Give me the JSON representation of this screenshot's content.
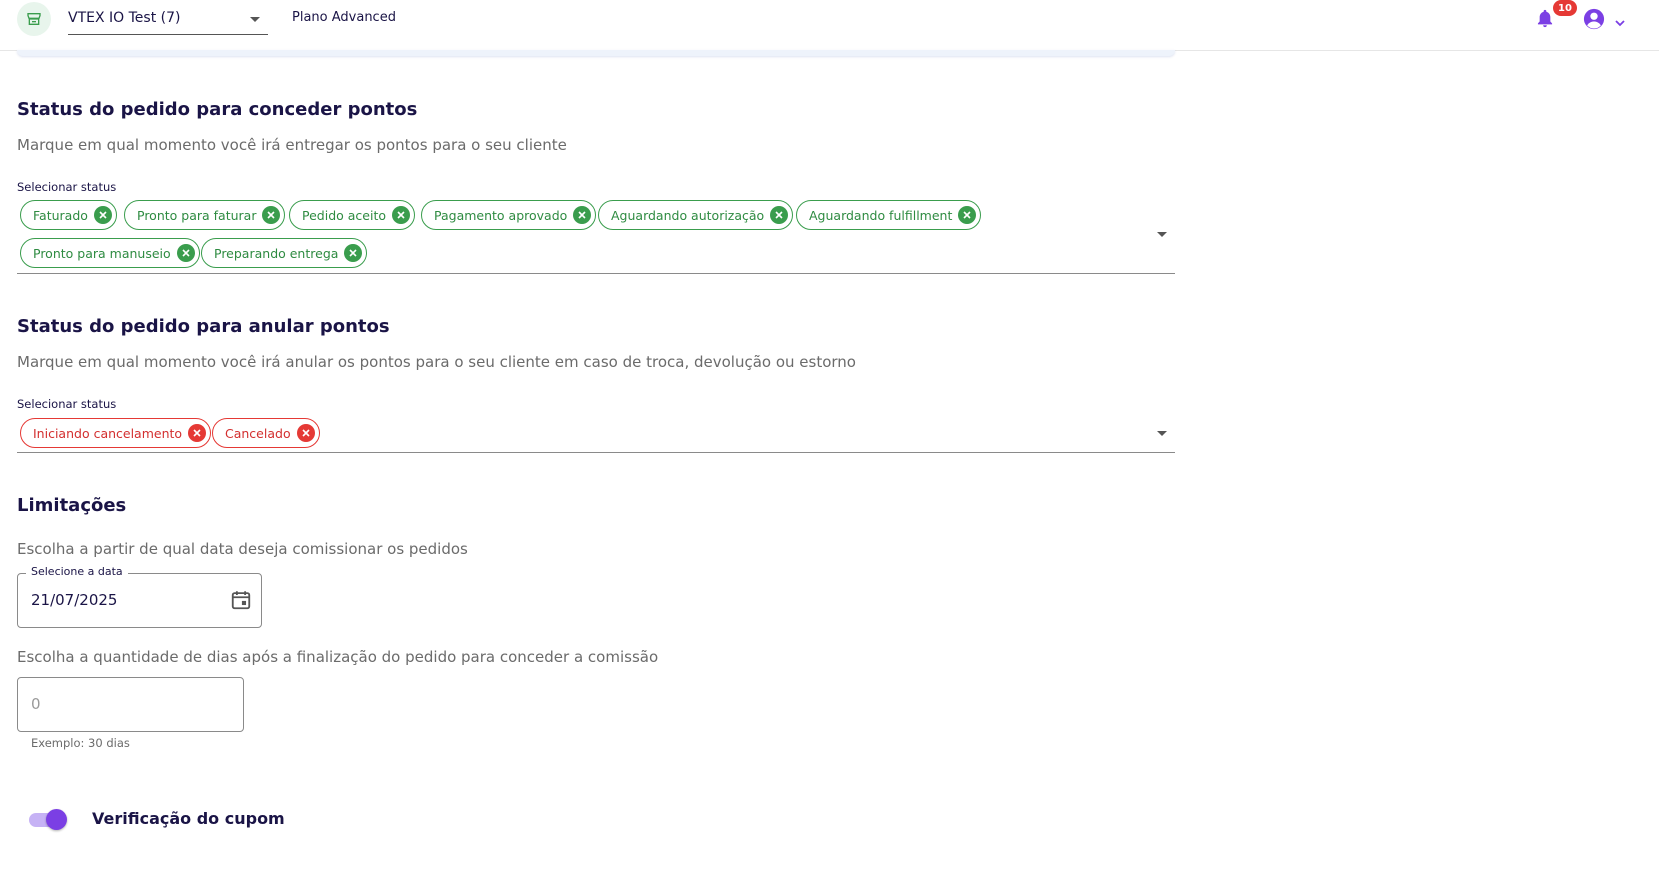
{
  "header": {
    "store_name": "VTEX IO Test (7)",
    "plan": "Plano Advanced",
    "notification_count": "10",
    "icons": [
      "store-icon",
      "bell-icon",
      "account-icon",
      "chevron-down-icon"
    ]
  },
  "grant_section": {
    "title": "Status do pedido para conceder pontos",
    "description": "Marque em qual momento você irá entregar os pontos para o seu cliente",
    "select_label": "Selecionar status",
    "chips": [
      "Faturado",
      "Pronto para faturar",
      "Pedido aceito",
      "Pagamento aprovado",
      "Aguardando autorização",
      "Aguardando fulfillment",
      "Pronto para manuseio",
      "Preparando entrega"
    ],
    "chip_color": "#3a9d4d"
  },
  "cancel_section": {
    "title": "Status do pedido para anular pontos",
    "description": "Marque em qual momento você irá anular os pontos para o seu cliente em caso de troca, devolução ou estorno",
    "select_label": "Selecionar status",
    "chips": [
      "Iniciando cancelamento",
      "Cancelado"
    ],
    "chip_color": "#e53935"
  },
  "limits": {
    "title": "Limitações",
    "date_prompt": "Escolha a partir de qual data deseja comissionar os pedidos",
    "date_label": "Selecione a data",
    "date_value": "21/07/2025",
    "days_prompt": "Escolha a quantidade de dias após a finalização do pedido para conceder a comissão",
    "days_placeholder": "0",
    "days_helper": "Exemplo: 30 dias"
  },
  "coupon": {
    "label": "Verificação do cupom",
    "enabled": true,
    "accent": "#7b3fe4"
  }
}
